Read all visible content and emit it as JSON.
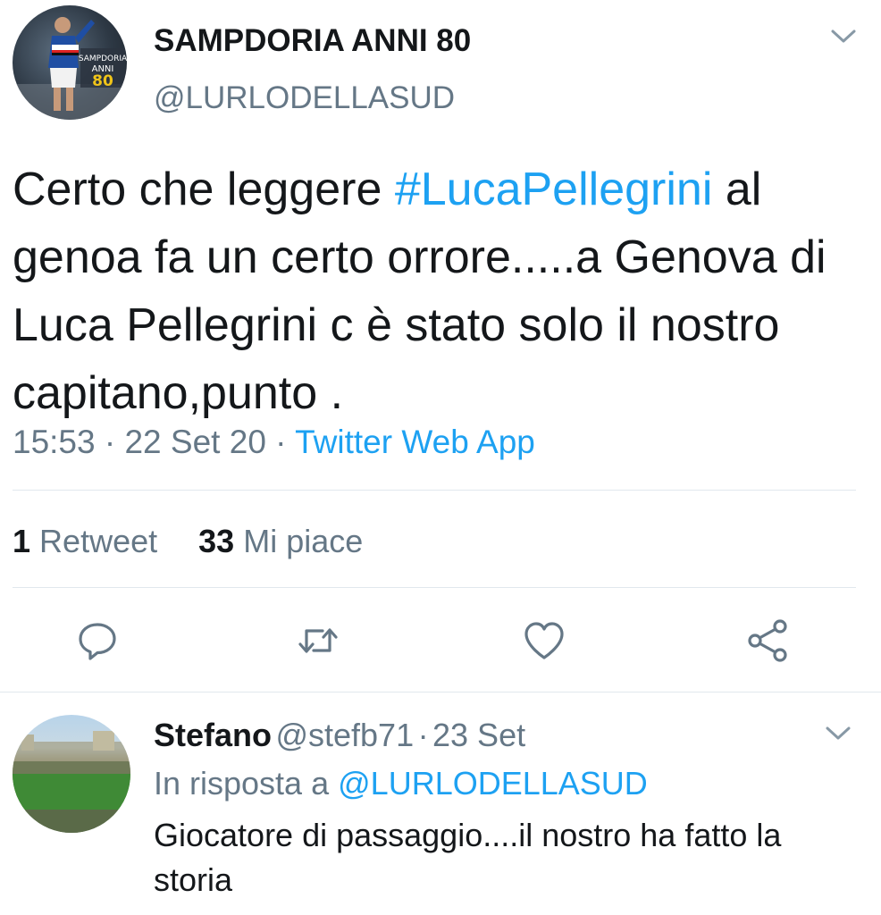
{
  "tweet": {
    "author": {
      "display_name": "SAMPDORIA ANNI 80",
      "handle": "@LURLODELLASUD",
      "avatar_text": "SAMPDORIA ANNI 80"
    },
    "text_before": "Certo che leggere ",
    "hashtag": "#LucaPellegrini",
    "text_after": " al genoa fa un certo orrore.....a Genova di Luca Pellegrini c è stato solo il nostro capitano,punto .",
    "time": "15:53",
    "date": "22 Set 20",
    "separator": "·",
    "source": "Twitter Web App",
    "retweets_count": "1",
    "retweets_label": "Retweet",
    "likes_count": "33",
    "likes_label": "Mi piace",
    "actions": [
      "reply-icon",
      "retweet-icon",
      "heart-icon",
      "share-icon"
    ]
  },
  "reply": {
    "author": {
      "display_name": "Stefano",
      "handle": "@stefb71",
      "date": "23 Set"
    },
    "in_reply_prefix": "In risposta a",
    "in_reply_handle": "@LURLODELLASUD",
    "text": "Giocatore di passaggio....il nostro ha fatto la storia"
  },
  "colors": {
    "link": "#1da1f2",
    "secondary_text": "#657786",
    "divider": "#e1e8ed"
  }
}
